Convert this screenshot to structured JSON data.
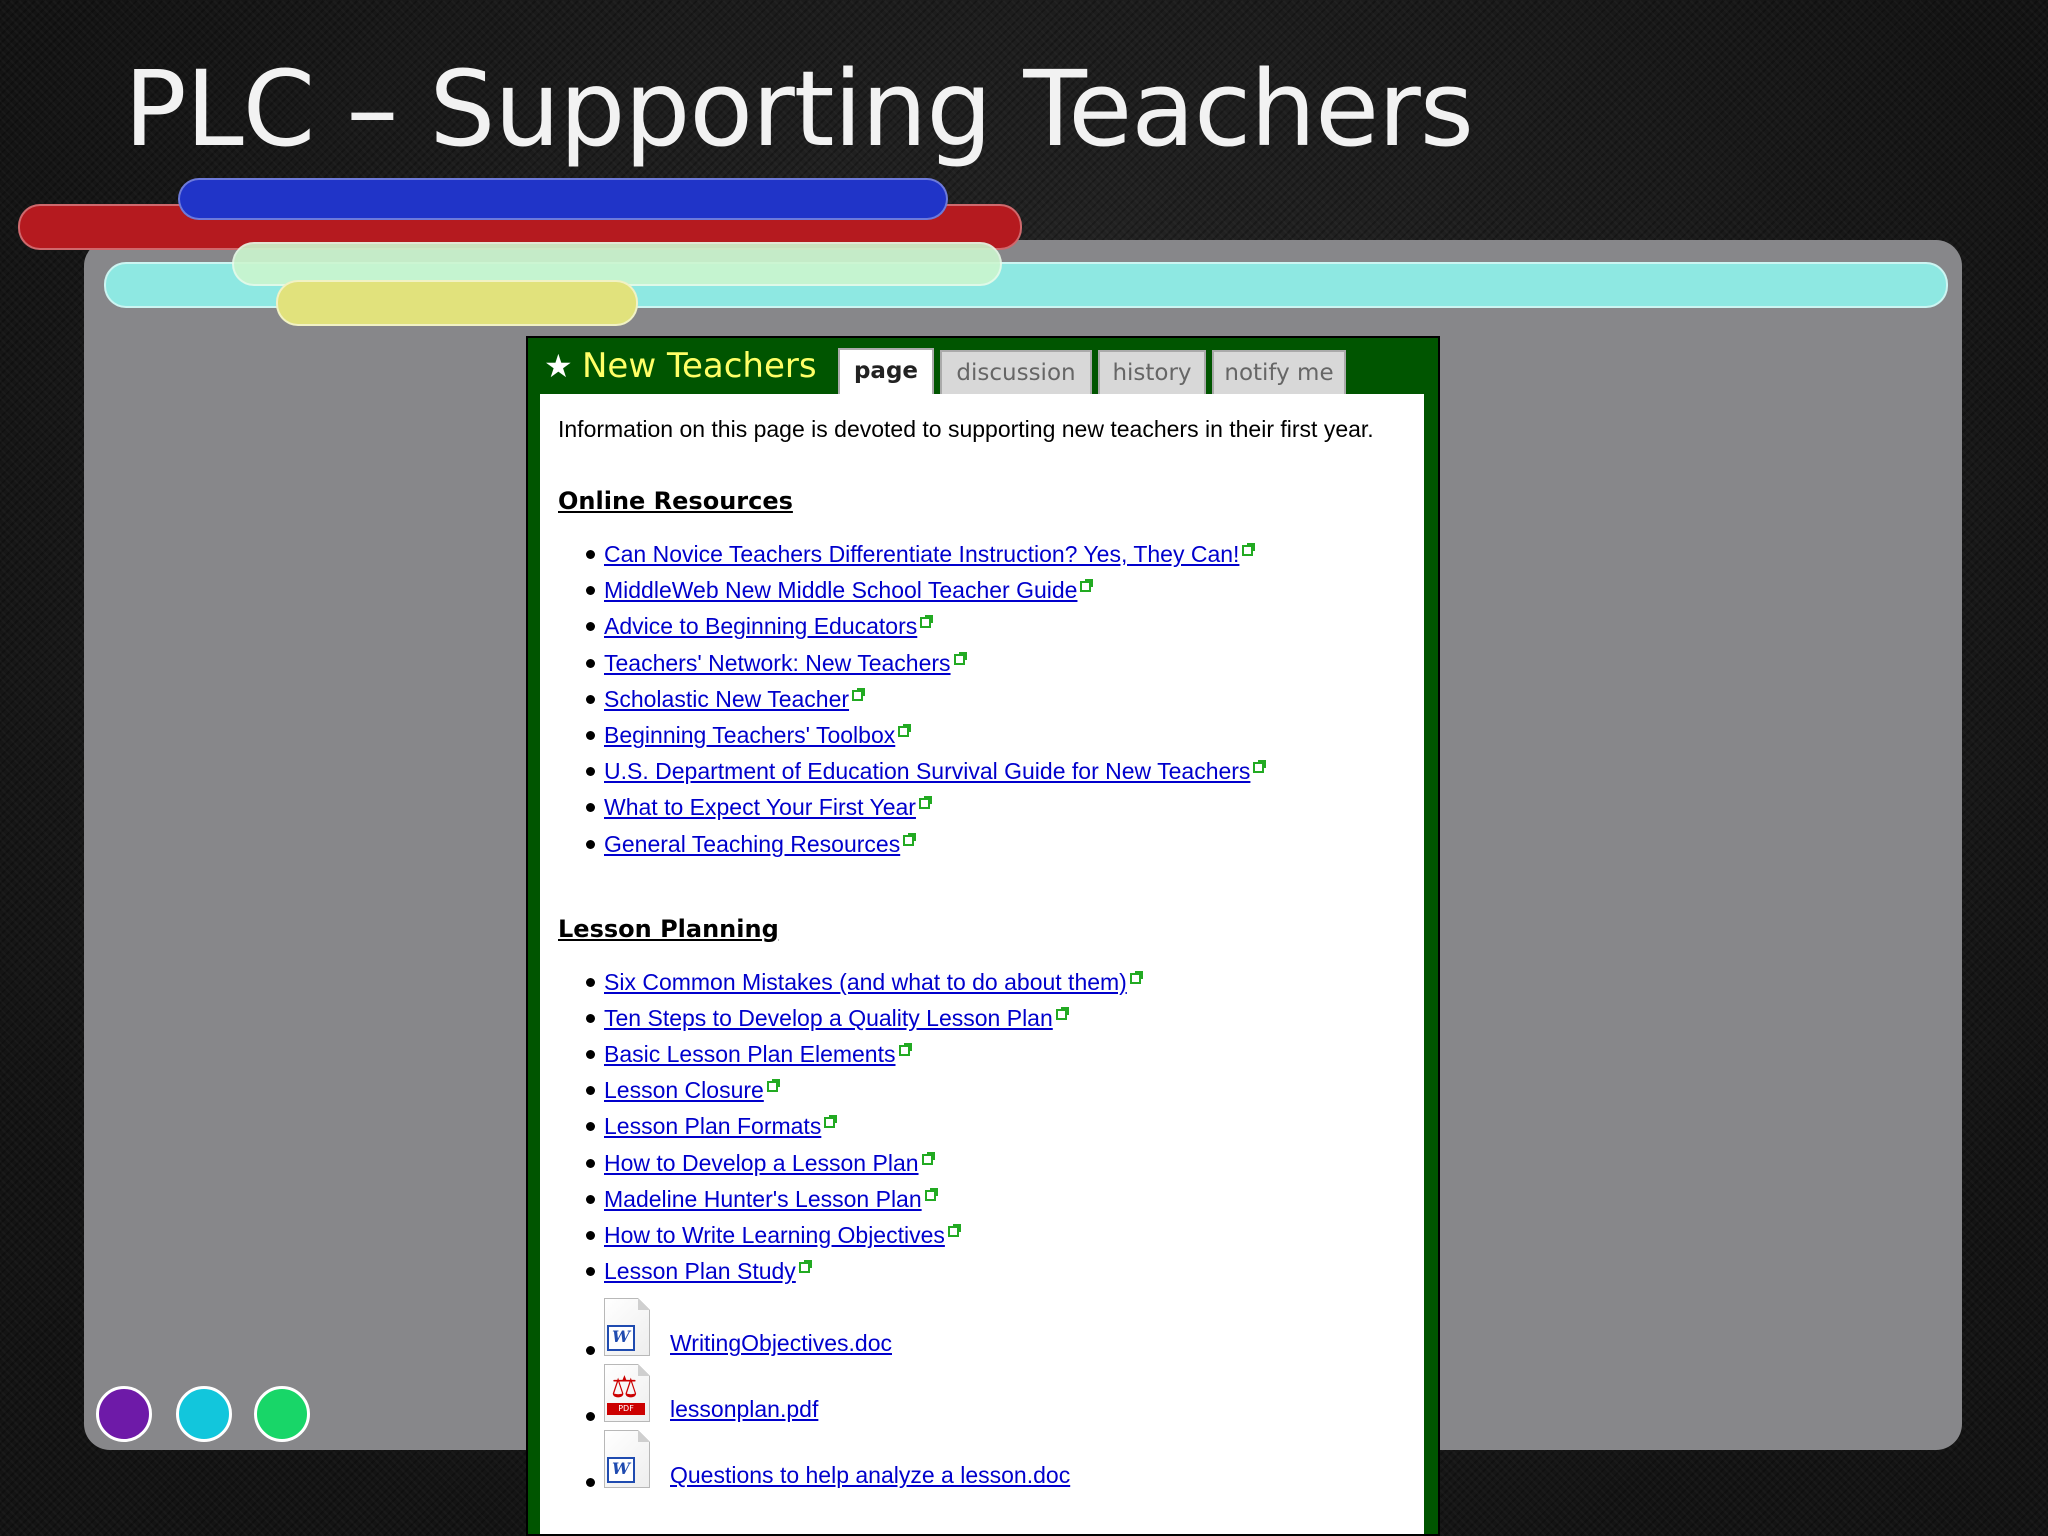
{
  "slide": {
    "title": "PLC – Supporting Teachers",
    "colors": {
      "background": "#1b1b1b",
      "panel": "#87878a",
      "bar_cyan": "#8ee8e2",
      "bar_red": "#b51a1f",
      "bar_blue": "#2034c8",
      "bar_yellow": "#e1e27c",
      "dot_purple": "#6e1aa8",
      "dot_cyan": "#12c6dc",
      "dot_green": "#18d668"
    }
  },
  "wiki": {
    "page_name": "New Teachers",
    "page_icon": "star-icon",
    "colors": {
      "header_bg": "#005500",
      "page_name": "#ffff66",
      "link": "#0000cc",
      "external_icon": "#22aa22"
    },
    "tabs": [
      {
        "label": "page",
        "active": true
      },
      {
        "label": "discussion",
        "active": false
      },
      {
        "label": "history",
        "active": false
      },
      {
        "label": "notify me",
        "active": false
      }
    ],
    "intro": "Information on this page is devoted to supporting new teachers in their first year.",
    "online_resources": {
      "heading": "Online Resources",
      "links": [
        "Can Novice Teachers Differentiate Instruction? Yes, They Can!",
        "MiddleWeb New Middle School Teacher Guide",
        "Advice to Beginning Educators",
        "Teachers' Network: New Teachers",
        "Scholastic New Teacher",
        "Beginning Teachers' Toolbox",
        "U.S. Department of Education Survival Guide for New Teachers",
        "What to Expect Your First Year",
        "General Teaching Resources"
      ]
    },
    "lesson_planning": {
      "heading": "Lesson Planning",
      "links": [
        "Six Common Mistakes (and what to do about them)",
        "Ten Steps to Develop a Quality Lesson Plan",
        "Basic Lesson Plan Elements",
        "Lesson Closure",
        "Lesson Plan Formats",
        "How to Develop a Lesson Plan",
        "Madeline Hunter's Lesson Plan",
        "How to Write Learning Objectives",
        "Lesson Plan Study"
      ],
      "files": [
        {
          "name": "WritingObjectives.doc",
          "icon": "word-document-icon"
        },
        {
          "name": "lessonplan.pdf",
          "icon": "pdf-document-icon"
        },
        {
          "name": "Questions to help analyze a lesson.doc",
          "icon": "word-document-icon"
        }
      ]
    }
  }
}
